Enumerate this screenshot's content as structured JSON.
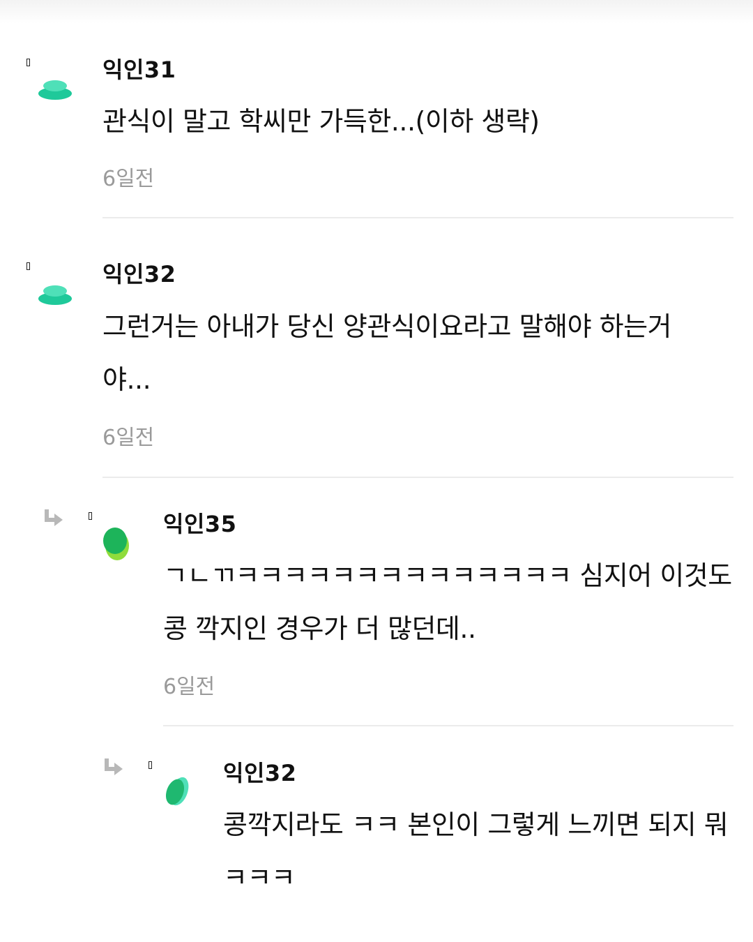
{
  "comments": [
    {
      "nickname": "익인31",
      "text": "관식이 말고 학씨만 가득한...(이하 생략)",
      "time": "6일전"
    },
    {
      "nickname": "익인32",
      "text": "그런거는 아내가 당신 양관식이요라고 말해야 하는거 야...",
      "time": "6일전"
    },
    {
      "nickname": "익인35",
      "text": "ㄱㄴㄲㅋㅋㅋㅋㅋㅋㅋㅋㅋㅋㅋㅋㅋㅋ 심지어 이것도 콩 깍지인 경우가 더 많던데..",
      "time": "6일전"
    },
    {
      "nickname": "익인32",
      "text": "콩깍지라도 ㅋㅋ 본인이 그렇게 느끼면 되지 뭐 ㅋㅋㅋ"
    }
  ],
  "colors": {
    "avatar_teal": "#1fc99a",
    "avatar_teal_light": "#4fe0b8",
    "avatar_green": "#1db45a",
    "avatar_lime": "#8fdc3c",
    "time_gray": "#9a9a9a",
    "divider": "#ebebeb",
    "reply_arrow": "#b8b8b8"
  },
  "icons": {
    "avatar": "avatar-icon",
    "reply": "reply-arrow-icon",
    "marker": "marker-icon"
  }
}
